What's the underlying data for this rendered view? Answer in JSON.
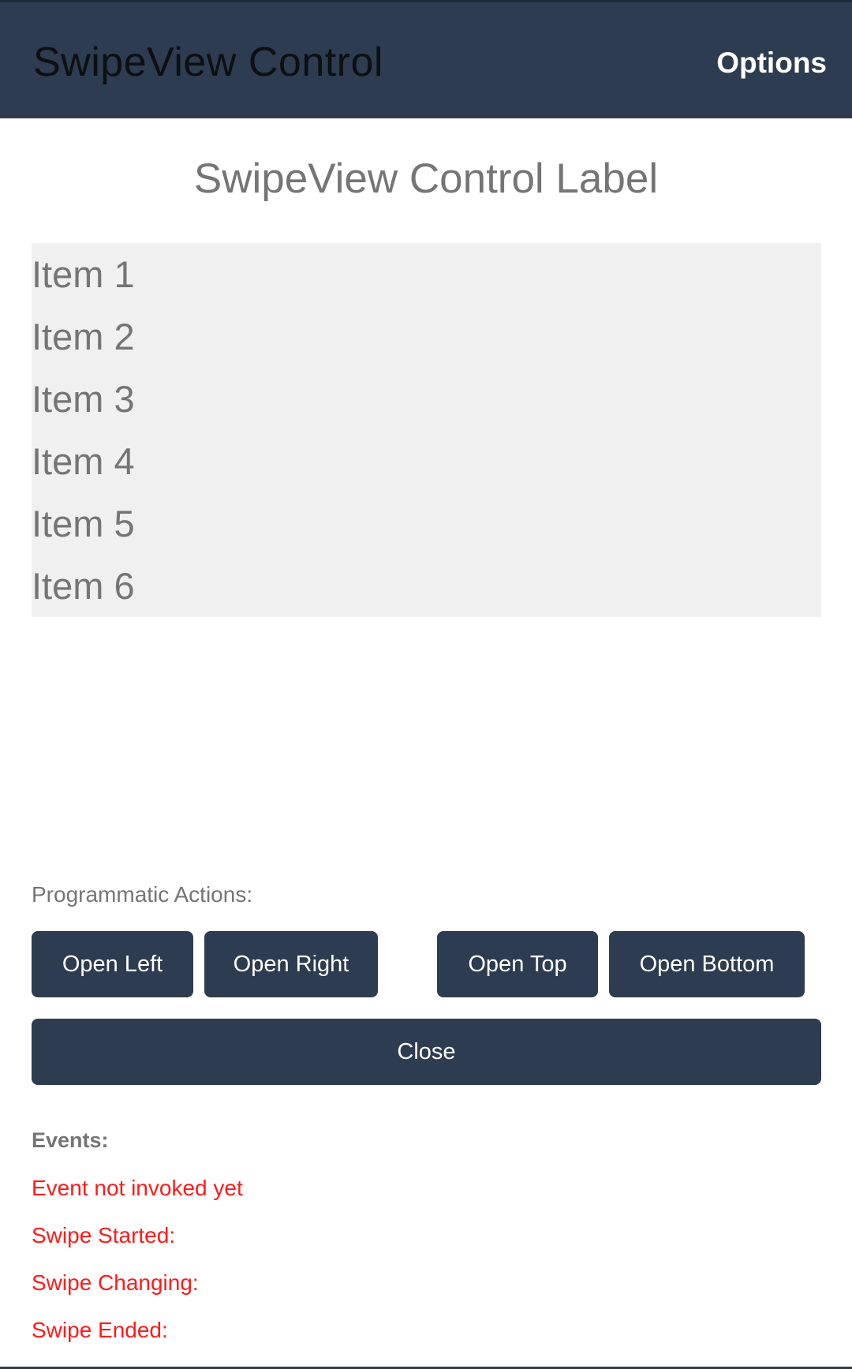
{
  "app_bar": {
    "title": "SwipeView Control",
    "options_label": "Options"
  },
  "content": {
    "control_label": "SwipeView Control Label",
    "items": [
      "Item 1",
      "Item 2",
      "Item 3",
      "Item 4",
      "Item 5",
      "Item 6"
    ]
  },
  "actions": {
    "section_label": "Programmatic Actions:",
    "open_left": "Open Left",
    "open_right": "Open Right",
    "open_top": "Open Top",
    "open_bottom": "Open Bottom",
    "close": "Close"
  },
  "events": {
    "section_label": "Events:",
    "status": "Event not invoked yet",
    "swipe_started": "Swipe Started:",
    "swipe_changing": "Swipe Changing:",
    "swipe_ended": "Swipe Ended:"
  },
  "colors": {
    "primary": "#2d3c50",
    "list_background": "#f0f0f0",
    "event_text": "#ff1a1a",
    "muted_text": "#757575"
  }
}
